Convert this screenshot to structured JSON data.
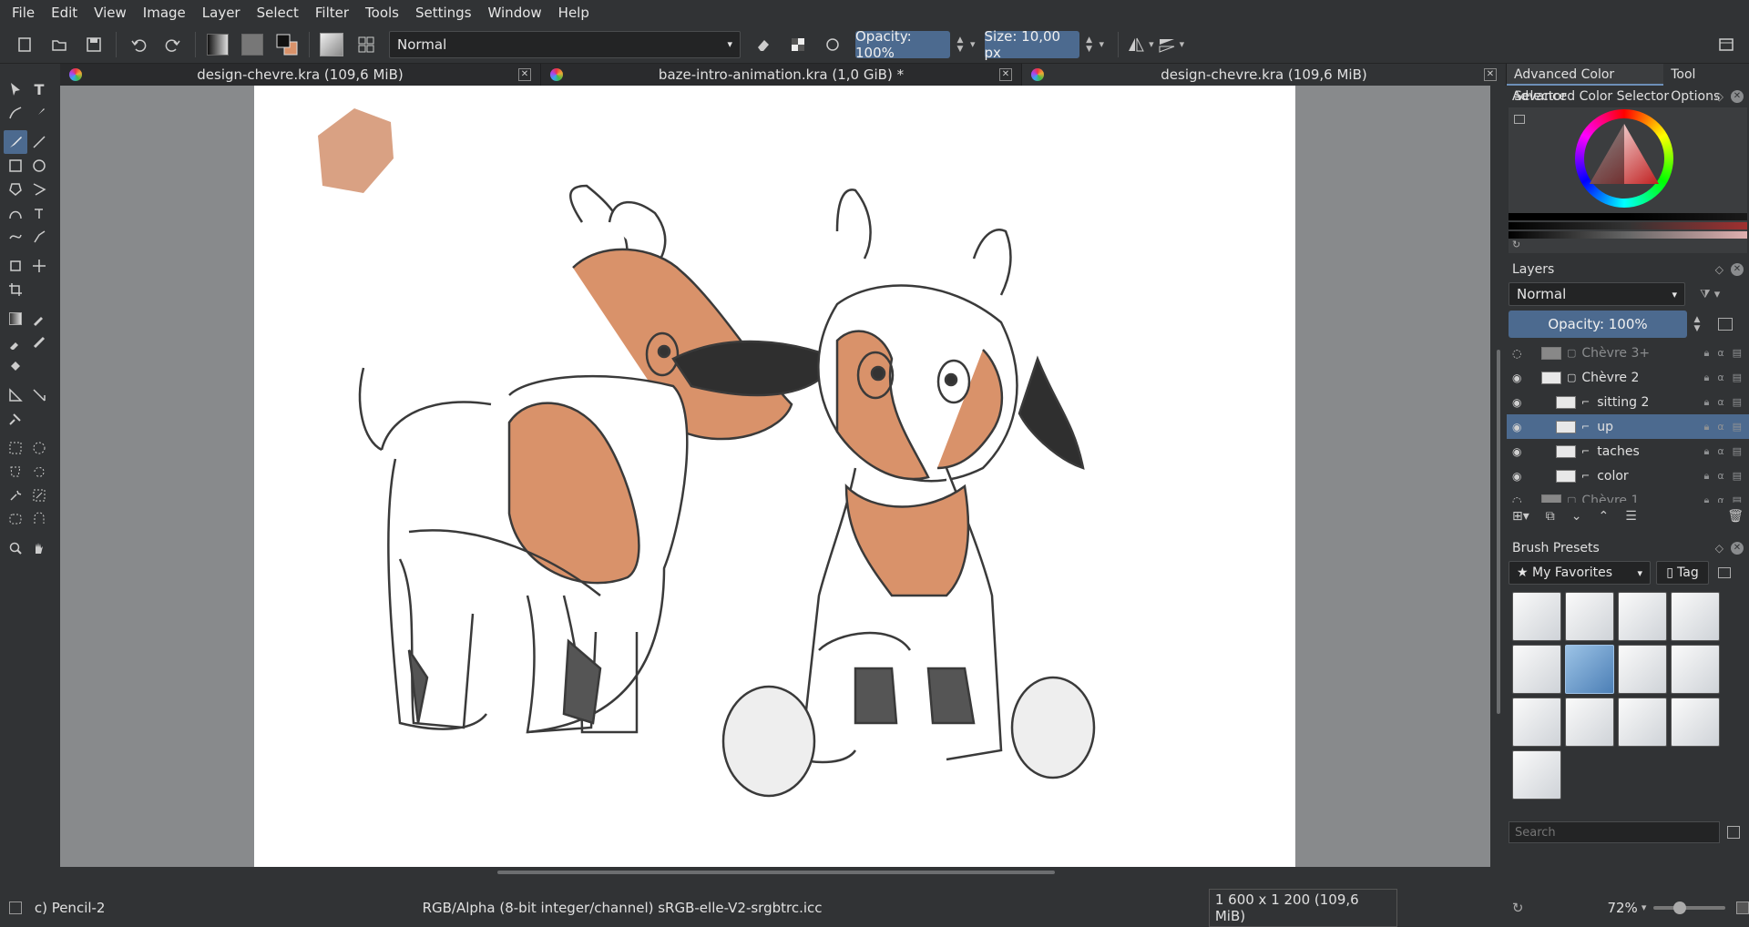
{
  "menu": [
    "File",
    "Edit",
    "View",
    "Image",
    "Layer",
    "Select",
    "Filter",
    "Tools",
    "Settings",
    "Window",
    "Help"
  ],
  "toolbar": {
    "blend_mode": "Normal",
    "opacity": "Opacity: 100%",
    "size": "Size: 10,00 px"
  },
  "tabs": [
    {
      "title": "design-chevre.kra (109,6 MiB)"
    },
    {
      "title": "baze-intro-animation.kra (1,0 GiB) *"
    },
    {
      "title": "design-chevre.kra (109,6 MiB)"
    }
  ],
  "dock": {
    "tabs": [
      "Advanced Color Selector",
      "Tool Options"
    ],
    "color_selector_title": "Advanced Color Selector",
    "layers": {
      "title": "Layers",
      "blend_mode": "Normal",
      "opacity": "Opacity:  100%",
      "items": [
        {
          "name": "Chèvre 3+",
          "visible": false,
          "indent": 0
        },
        {
          "name": "Chèvre 2",
          "visible": true,
          "indent": 0
        },
        {
          "name": "sitting 2",
          "visible": true,
          "indent": 1
        },
        {
          "name": "up",
          "visible": true,
          "indent": 1,
          "selected": true
        },
        {
          "name": "taches",
          "visible": true,
          "indent": 1
        },
        {
          "name": "color",
          "visible": true,
          "indent": 1
        },
        {
          "name": "Chèvre 1",
          "visible": false,
          "indent": 0
        }
      ]
    },
    "brush_presets": {
      "title": "Brush Presets",
      "tag_filter": "★ My Favorites",
      "tag_button": "Tag",
      "search_placeholder": "Search",
      "count": 13,
      "selected_index": 5
    }
  },
  "status": {
    "tool": "c) Pencil-2",
    "color_profile": "RGB/Alpha (8-bit integer/channel)  sRGB-elle-V2-srgbtrc.icc",
    "dimensions": "1 600 x 1 200 (109,6 MiB)",
    "zoom": "72%"
  },
  "colors": {
    "accent": "#4c6a8f",
    "bg": "#313335",
    "fur": "#d9926a"
  }
}
